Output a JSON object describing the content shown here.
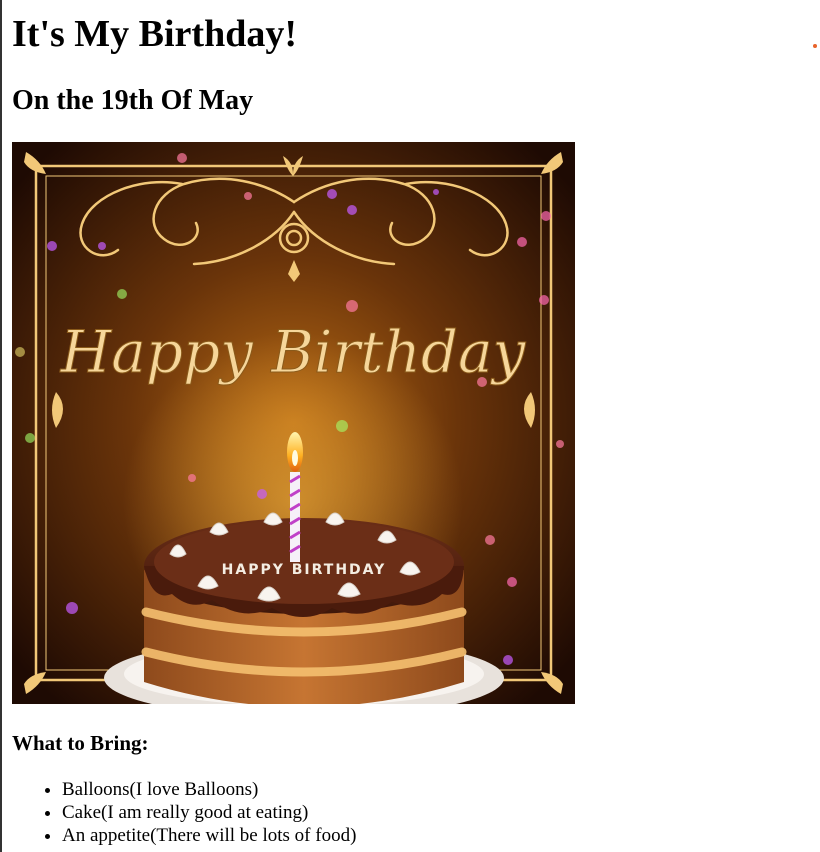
{
  "page": {
    "title": "It's My Birthday!",
    "subtitle": "On the 19th Of May"
  },
  "image": {
    "text": "Happy Birthday",
    "cake_text": "HAPPY BIRTHDAY"
  },
  "bring": {
    "heading": "What to Bring:",
    "items": [
      "Balloons(I love Balloons)",
      "Cake(I am really good at eating)",
      "An appetite(There will be lots of food)"
    ]
  },
  "colors": {
    "accent_dot": "#e8632b",
    "frame_gold": "#f2c878",
    "background_dark": "#2a1206"
  }
}
